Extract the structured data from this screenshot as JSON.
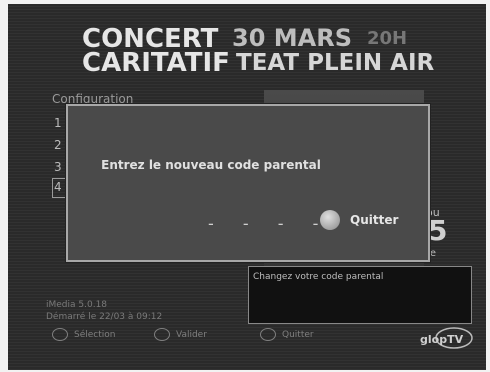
{
  "banner": {
    "line1": "CONCERT",
    "line2": "CARITATIF",
    "date": "30 MARS",
    "hour": "20H",
    "venue": "TEAT PLEIN AIR"
  },
  "config": {
    "title": "Configuration",
    "items": [
      "1",
      "2",
      "3",
      "4"
    ]
  },
  "thumbnail": {
    "big_digit": "5",
    "partial_top": "ou",
    "partial_bottom": "re"
  },
  "help": {
    "text": "Changez votre code parental"
  },
  "system": {
    "version": "iMedia 5.0.18",
    "boot": "Démarré le 22/03 à 09:12"
  },
  "footer": {
    "select_label": "Sélection",
    "validate_label": "Valider",
    "quit_label": "Quitter"
  },
  "logo": {
    "text": "glopTV"
  },
  "dialog": {
    "prompt": "Entrez le nouveau code parental",
    "code_placeholder": "- - - -",
    "quit_label": "Quitter"
  }
}
